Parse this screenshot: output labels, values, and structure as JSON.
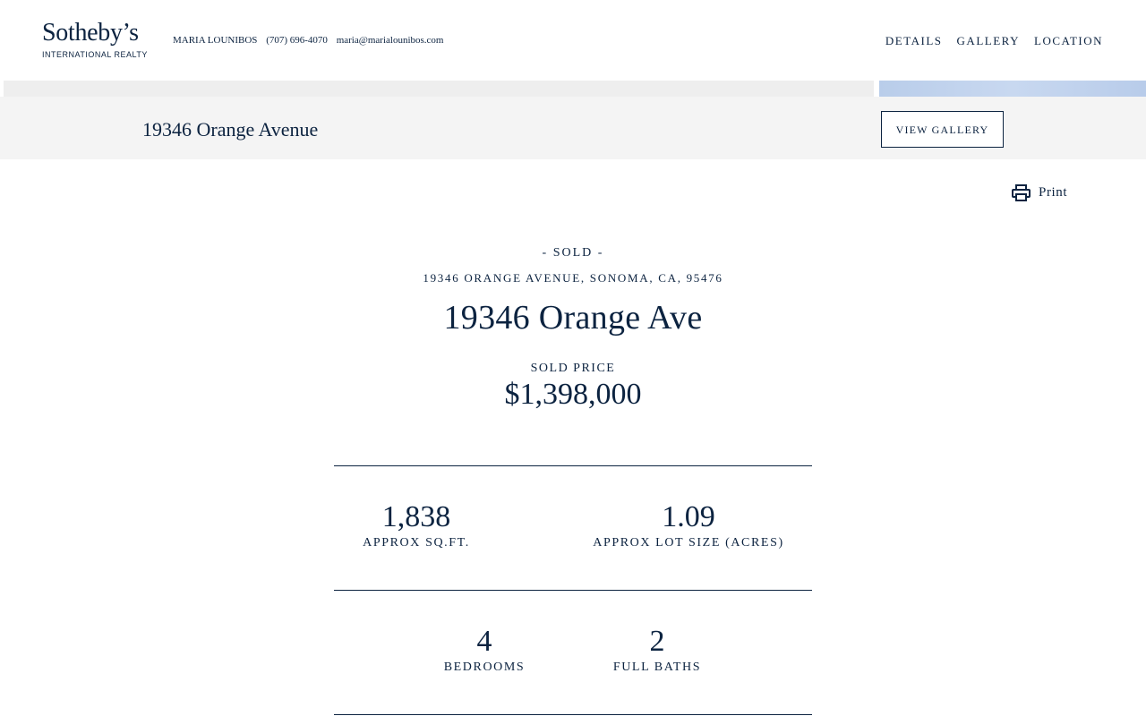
{
  "header": {
    "logo_main": "Sotheby’s",
    "logo_sub": "INTERNATIONAL REALTY",
    "agent_name": "MARIA LOUNIBOS",
    "agent_phone": "(707) 696-4070",
    "agent_email": "maria@marialounibos.com",
    "nav": [
      "DETAILS",
      "GALLERY",
      "LOCATION"
    ]
  },
  "title_bar": {
    "title": "19346 Orange Avenue",
    "view_gallery_label": "VIEW GALLERY"
  },
  "print_label": "Print",
  "listing": {
    "status": "- SOLD -",
    "full_address": "19346 ORANGE AVENUE, SONOMA, CA, 95476",
    "name": "19346 Orange Ave",
    "price_label": "SOLD PRICE",
    "price": "$1,398,000",
    "stats": [
      {
        "value": "1,838",
        "label": "APPROX SQ.FT."
      },
      {
        "value": "1.09",
        "label": "APPROX LOT SIZE (ACRES)"
      },
      {
        "value": "4",
        "label": "BEDROOMS"
      },
      {
        "value": "2",
        "label": "FULL BATHS"
      }
    ]
  },
  "colors": {
    "brand": "#0c2340",
    "title_bar_bg": "#f4f4f4"
  },
  "icons": {
    "print": "printer-icon"
  }
}
